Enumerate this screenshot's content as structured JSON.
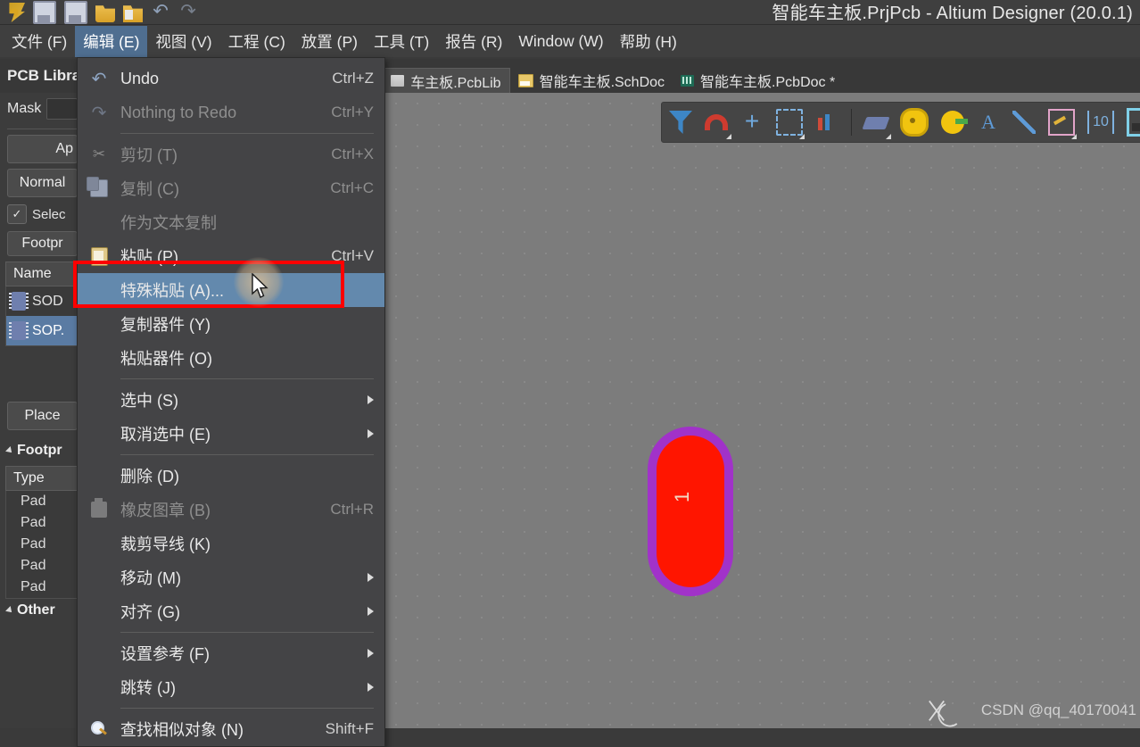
{
  "window": {
    "title": "智能车主板.PrjPcb - Altium Designer (20.0.1)",
    "quick_access": [
      {
        "name": "altium-logo-icon",
        "label": "Altium"
      },
      {
        "name": "save-icon",
        "label": "保存"
      },
      {
        "name": "save-all-icon",
        "label": "全部保存"
      },
      {
        "name": "open-icon",
        "label": "打开"
      },
      {
        "name": "open-project-icon",
        "label": "打开工程"
      },
      {
        "name": "undo-icon",
        "label": "撤销"
      },
      {
        "name": "redo-icon",
        "label": "重做"
      }
    ]
  },
  "menubar": {
    "items": [
      {
        "label": "文件 (F)",
        "active": false
      },
      {
        "label": "编辑 (E)",
        "active": true
      },
      {
        "label": "视图 (V)",
        "active": false
      },
      {
        "label": "工程 (C)",
        "active": false
      },
      {
        "label": "放置 (P)",
        "active": false
      },
      {
        "label": "工具 (T)",
        "active": false
      },
      {
        "label": "报告 (R)",
        "active": false
      },
      {
        "label": "Window (W)",
        "active": false
      },
      {
        "label": "帮助 (H)",
        "active": false
      }
    ]
  },
  "panel_header": {
    "title": "PCB Libra"
  },
  "tabs": [
    {
      "label": "车主板.PcbLib",
      "icon": "pcblib-icon",
      "selected": true,
      "modified": false
    },
    {
      "label": "智能车主板.SchDoc",
      "icon": "schdoc-icon",
      "selected": false,
      "modified": false
    },
    {
      "label": "智能车主板.PcbDoc *",
      "icon": "pcbdoc-icon",
      "selected": false,
      "modified": true
    }
  ],
  "edit_menu": {
    "items": [
      {
        "label": "Undo",
        "shortcut": "Ctrl+Z",
        "icon": "undo-icon",
        "disabled": false,
        "submenu": false,
        "highlighted": false
      },
      {
        "label": "Nothing to Redo",
        "shortcut": "Ctrl+Y",
        "icon": "redo-icon",
        "disabled": true,
        "submenu": false,
        "highlighted": false
      },
      {
        "separator": true
      },
      {
        "label": "剪切 (T)",
        "shortcut": "Ctrl+X",
        "icon": "cut-icon",
        "disabled": true,
        "submenu": false,
        "highlighted": false
      },
      {
        "label": "复制 (C)",
        "shortcut": "Ctrl+C",
        "icon": "copy-icon",
        "disabled": true,
        "submenu": false,
        "highlighted": false
      },
      {
        "label": "作为文本复制",
        "shortcut": "",
        "icon": "",
        "disabled": true,
        "submenu": false,
        "highlighted": false
      },
      {
        "label": "粘贴 (P)",
        "shortcut": "Ctrl+V",
        "icon": "paste-icon",
        "disabled": false,
        "submenu": false,
        "highlighted": false
      },
      {
        "label": "特殊粘贴 (A)...",
        "shortcut": "",
        "icon": "",
        "disabled": false,
        "submenu": false,
        "highlighted": true
      },
      {
        "label": "复制器件 (Y)",
        "shortcut": "",
        "icon": "",
        "disabled": false,
        "submenu": false,
        "highlighted": false
      },
      {
        "label": "粘贴器件 (O)",
        "shortcut": "",
        "icon": "",
        "disabled": false,
        "submenu": false,
        "highlighted": false
      },
      {
        "separator": true
      },
      {
        "label": "选中 (S)",
        "shortcut": "",
        "icon": "",
        "disabled": false,
        "submenu": true,
        "highlighted": false
      },
      {
        "label": "取消选中 (E)",
        "shortcut": "",
        "icon": "",
        "disabled": false,
        "submenu": true,
        "highlighted": false
      },
      {
        "separator": true
      },
      {
        "label": "删除 (D)",
        "shortcut": "",
        "icon": "",
        "disabled": false,
        "submenu": false,
        "highlighted": false
      },
      {
        "label": "橡皮图章 (B)",
        "shortcut": "Ctrl+R",
        "icon": "stamp-icon",
        "disabled": true,
        "submenu": false,
        "highlighted": false
      },
      {
        "label": "裁剪导线 (K)",
        "shortcut": "",
        "icon": "",
        "disabled": false,
        "submenu": false,
        "highlighted": false
      },
      {
        "label": "移动 (M)",
        "shortcut": "",
        "icon": "",
        "disabled": false,
        "submenu": true,
        "highlighted": false
      },
      {
        "label": "对齐 (G)",
        "shortcut": "",
        "icon": "",
        "disabled": false,
        "submenu": true,
        "highlighted": false
      },
      {
        "separator": true
      },
      {
        "label": "设置参考 (F)",
        "shortcut": "",
        "icon": "",
        "disabled": false,
        "submenu": true,
        "highlighted": false
      },
      {
        "label": "跳转 (J)",
        "shortcut": "",
        "icon": "",
        "disabled": false,
        "submenu": true,
        "highlighted": false
      },
      {
        "separator": true
      },
      {
        "label": "查找相似对象 (N)",
        "shortcut": "Shift+F",
        "icon": "find-icon",
        "disabled": false,
        "submenu": false,
        "highlighted": false
      }
    ]
  },
  "left_panel": {
    "mask_label": "Mask",
    "apply_button": "Ap",
    "normal_button": "Normal",
    "select_checkbox_label": "Selec",
    "select_checked": true,
    "footprint_filter_label": "Footpr",
    "name_column": "Name",
    "components": [
      {
        "name": "SOD",
        "selected": false
      },
      {
        "name": "SOP.",
        "selected": true
      }
    ],
    "place_button": "Place",
    "footprint_section": "Footpr",
    "type_column": "Type",
    "type_rows": [
      "Pad",
      "Pad",
      "Pad",
      "Pad",
      "Pad"
    ],
    "other_section": "Other"
  },
  "pcb_toolbar": {
    "buttons": [
      {
        "name": "filter-icon",
        "label": "过滤"
      },
      {
        "name": "magnet-snap-icon",
        "label": "捕捉"
      },
      {
        "name": "crosshair-icon",
        "label": "十字准线"
      },
      {
        "name": "marquee-select-icon",
        "label": "框选"
      },
      {
        "name": "layer-stack-icon",
        "label": "层叠"
      },
      {
        "name": "place-component-icon",
        "label": "放置器件"
      },
      {
        "name": "place-pad-icon",
        "label": "放置焊盘"
      },
      {
        "name": "place-via-icon",
        "label": "放置过孔"
      },
      {
        "name": "place-string-icon",
        "label": "放置字符串"
      },
      {
        "name": "place-line-icon",
        "label": "放置线"
      },
      {
        "name": "place-region-icon",
        "label": "放置区域"
      },
      {
        "name": "place-dimension-icon",
        "label": "放置尺寸"
      },
      {
        "name": "place-polygon-icon",
        "label": "放置铺铜"
      }
    ]
  },
  "canvas": {
    "pad_designator": "1",
    "pad_fill_color": "#ff1500",
    "pad_outline_color": "#a132c9",
    "background_color": "#7c7c7c"
  },
  "watermark": {
    "text": "CSDN @qq_40170041"
  },
  "annotation": {
    "color": "#ff0000",
    "target_label": "特殊粘贴 (A)..."
  }
}
